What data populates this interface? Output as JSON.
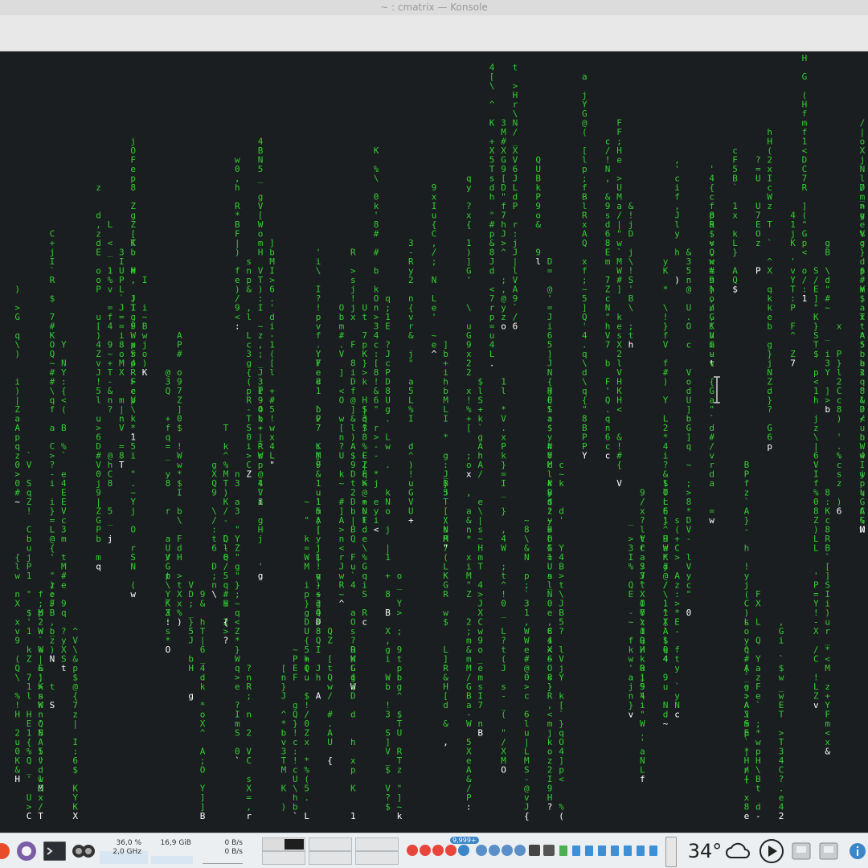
{
  "window": {
    "title": "~ : cmatrix — Konsole"
  },
  "terminal": {
    "program": "cmatrix",
    "text_color": "#33cc33",
    "highlight_color": "#ffffff",
    "background": "#1b1e20"
  },
  "taskbar": {
    "cpu_percent": "36,0 %",
    "cpu_freq": "2,0 GHz",
    "memory": "16,9 GiB",
    "net_down": "0 B/s",
    "net_up": "0 B/s",
    "notification_badge": "9,999+",
    "temperature": "34°",
    "icons": {
      "launcher": "app-launcher-icon",
      "browser": "browser-icon",
      "terminal": "terminal-icon",
      "monitor": "system-monitor-icon",
      "weather": "cloud-icon",
      "media": "play-icon",
      "info": "info-icon"
    }
  }
}
